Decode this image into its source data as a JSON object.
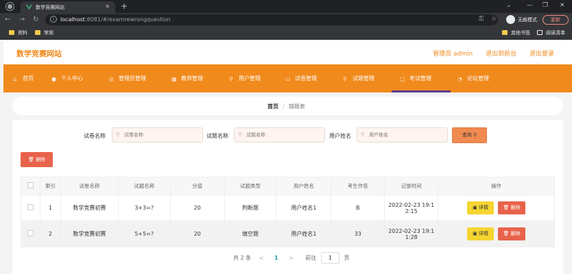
{
  "browser": {
    "tab_title": "数学竞赛网站",
    "url_host": "localhost",
    "url_path": ":8081/#/examrewrongquestion",
    "incognito_label": "无痕模式",
    "update_label": "更新",
    "bookmarks": [
      "资料",
      "常用"
    ],
    "other_bookmarks": "其他书签",
    "reading_list": "阅读清单"
  },
  "header": {
    "site_title": "数学竞赛网站",
    "admin_label": "管理员 admin",
    "back_label": "退出到前台",
    "logout_label": "退出登录"
  },
  "nav": {
    "items": [
      {
        "label": "首页",
        "icon": "home-icon"
      },
      {
        "label": "个人中心",
        "icon": "user-icon"
      },
      {
        "label": "管理员管理",
        "icon": "admin-icon"
      },
      {
        "label": "教师管理",
        "icon": "teacher-icon"
      },
      {
        "label": "用户管理",
        "icon": "users-icon"
      },
      {
        "label": "试卷管理",
        "icon": "paper-icon"
      },
      {
        "label": "试题管理",
        "icon": "question-icon"
      },
      {
        "label": "考试管理",
        "icon": "exam-icon"
      },
      {
        "label": "论坛管理",
        "icon": "forum-icon"
      }
    ],
    "active_index": 7,
    "active_color": "#5b3b8a",
    "bar_color": "#f18a1c"
  },
  "breadcrumb": {
    "home": "首页",
    "separator": "/",
    "current": "错题表"
  },
  "filters": {
    "paper_label": "试卷名称",
    "paper_placeholder": "试卷名称",
    "question_label": "试题名称",
    "question_placeholder": "试题名称",
    "user_label": "用户姓名",
    "user_placeholder": "用户姓名",
    "query_label": "查询"
  },
  "delete_label": "删除",
  "table": {
    "headers": [
      "索引",
      "试卷名称",
      "试题名称",
      "分值",
      "试题类型",
      "用户姓名",
      "考生作答",
      "记录时间",
      "操作"
    ],
    "detail_label": "详情",
    "delete_label": "删除",
    "rows": [
      {
        "index": "1",
        "paper": "数学竞赛初赛",
        "question": "3+3=?",
        "score": "20",
        "type": "判断题",
        "user": "用户姓名1",
        "answer": "B",
        "time1": "2022-02-23 19:1",
        "time2": "2:15"
      },
      {
        "index": "2",
        "paper": "数学竞赛初赛",
        "question": "5+5=?",
        "score": "20",
        "type": "填空题",
        "user": "用户姓名1",
        "answer": "33",
        "time1": "2022-02-23 19:1",
        "time2": "1:28"
      }
    ]
  },
  "pager": {
    "total": "共 2 条",
    "prev": "<",
    "page": "1",
    "next": ">",
    "goto_label": "前往",
    "goto_value": "1",
    "page_unit": "页"
  }
}
